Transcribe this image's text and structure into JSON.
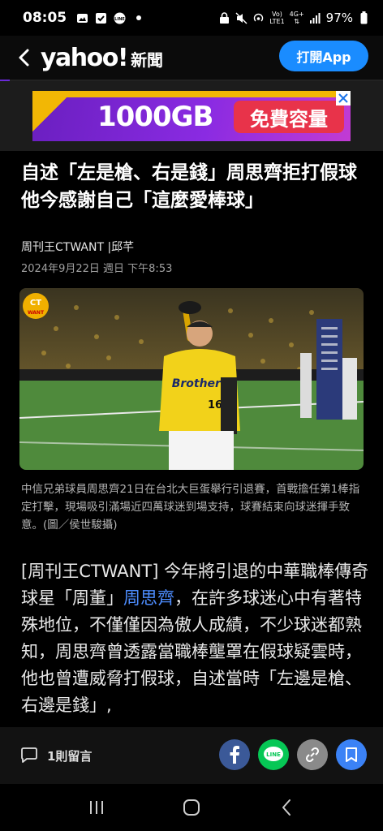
{
  "status_bar": {
    "time": "08:05",
    "network_top": "Vo)",
    "network_bottom": "LTE1",
    "signal_type_top": "4G+",
    "battery": "97%"
  },
  "app_bar": {
    "logo": "yahoo!",
    "logo_suffix": "新聞",
    "open_app_label": "打開App"
  },
  "ad": {
    "headline": "1000GB",
    "pill": "免費容量"
  },
  "article": {
    "headline": "自述「左是槍、右是錢」周思齊拒打假球 他今感謝自己「這麼愛棒球」",
    "byline": "周刊王CTWANT |邱芊",
    "date": "2024年9月22日 週日 下午8:53",
    "photo_logo_top": "CT",
    "photo_logo_bottom": "WANT",
    "jersey_team": "Brothers",
    "jersey_number": "16",
    "caption": "中信兄弟球員周思齊21日在台北大巨蛋舉行引退賽，首戰擔任第1棒指定打擊，現場吸引滿場近四萬球迷到場支持，球賽結束向球迷揮手致意。(圖／侯世駿攝)",
    "body_before": "[周刊王CTWANT] 今年將引退的中華職棒傳奇球星「周董」",
    "body_link": "周思齊",
    "body_after": "，在許多球迷心中有著特殊地位，不僅僅因為傲人成績，不少球迷都熟知，周思齊曾透露當職棒壟罩在假球疑雲時，他也曾遭威脅打假球，自述當時「左邊是槍、右邊是錢」,"
  },
  "toolbar": {
    "comment_count": "1則留言"
  },
  "colors": {
    "accent_blue": "#1a8cff",
    "link_blue": "#4d8dff",
    "facebook": "#3b5998",
    "line": "#06c755",
    "bookmark": "#3b82f6"
  },
  "icons": [
    "back-chevron-icon",
    "close-icon",
    "comment-icon",
    "facebook-icon",
    "line-icon",
    "link-icon",
    "bookmark-icon",
    "recents-icon",
    "home-icon",
    "back-icon"
  ]
}
